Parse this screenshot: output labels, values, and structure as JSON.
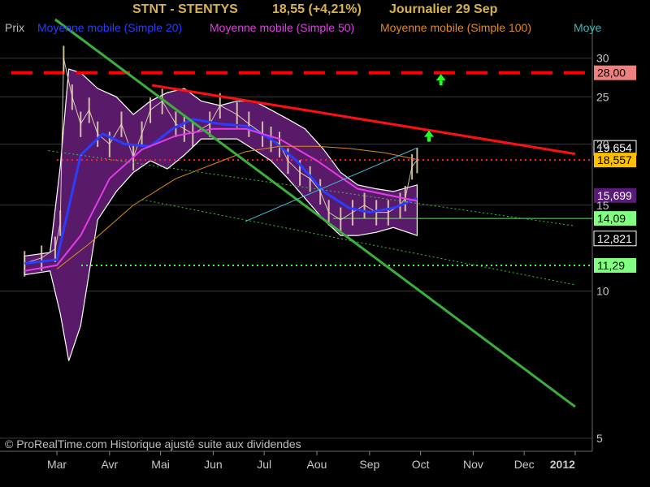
{
  "header": {
    "ticker": "STNT - STENTYS",
    "price": "18,55 (+4,21%)",
    "period": "Journalier  29 Sep"
  },
  "legend": [
    {
      "label": "Prix",
      "color": "#bdbdbd"
    },
    {
      "label": "Moyenne mobile (Simple 20)",
      "color": "#2a3cff"
    },
    {
      "label": "Moyenne mobile (Simple 50)",
      "color": "#e23ce6"
    },
    {
      "label": "Moyenne mobile (Simple 100)",
      "color": "#e08a1e"
    },
    {
      "label": "Moye",
      "color": "#3ab6b6"
    }
  ],
  "copyright": "© ProRealTime.com Historique ajusté suite aux dividendes",
  "chart_data": {
    "type": "line",
    "scale": "log",
    "background": "#000000",
    "grid": true,
    "x_tick_labels": [
      "Mar",
      "Avr",
      "Mai",
      "Jun",
      "Jul",
      "Aou",
      "Sep",
      "Oct",
      "Nov",
      "Dec",
      "2012"
    ],
    "y_tick_labels": [
      "5",
      "10",
      "15",
      "20",
      "25",
      "30"
    ],
    "ylim": [
      4.7,
      36
    ],
    "price_tags": [
      {
        "text": "28,00",
        "value": 28.0,
        "bg": "#f08080",
        "fg": "#000000"
      },
      {
        "text": "19,654",
        "value": 19.654,
        "bg": "#000000",
        "fg": "#ffffff",
        "border": "#ffffff"
      },
      {
        "text": "18,557",
        "value": 18.557,
        "bg": "#ffc000",
        "fg": "#000000"
      },
      {
        "text": "15,699",
        "value": 15.699,
        "bg": "#5a1a7a",
        "fg": "#ffffff"
      },
      {
        "text": "14,09",
        "value": 14.09,
        "bg": "#80ff80",
        "fg": "#000000"
      },
      {
        "text": "12,821",
        "value": 12.821,
        "bg": "#000000",
        "fg": "#ffffff",
        "border": "#ffffff"
      },
      {
        "text": "11,29",
        "value": 11.29,
        "bg": "#80ff80",
        "fg": "#000000"
      }
    ],
    "horizontal_lines": [
      {
        "name": "resistance-28",
        "value": 28.0,
        "color": "#ff0000",
        "style": "dashed-thick"
      },
      {
        "name": "level-18-55",
        "value": 18.557,
        "color": "#ff2020",
        "style": "dotted"
      },
      {
        "name": "level-14-09",
        "value": 14.09,
        "color": "#40ff40",
        "style": "solid-thin"
      },
      {
        "name": "level-11-29",
        "value": 11.29,
        "color": "#40ff40",
        "style": "dotted"
      }
    ],
    "trendlines": [
      {
        "name": "green-downtrend",
        "color": "#3ab03a",
        "points": [
          [
            "Feb 28",
            36
          ],
          [
            "Dec 31",
            5.8
          ]
        ]
      },
      {
        "name": "red-downtrend",
        "color": "#ff1010",
        "points": [
          [
            "Apr 26",
            26.4
          ],
          [
            "Dec 31",
            19.1
          ]
        ]
      },
      {
        "name": "channel-upper",
        "color": "#40c040",
        "points": [
          [
            "Feb 24",
            19.4
          ],
          [
            "Dec 31",
            13.6
          ]
        ]
      },
      {
        "name": "channel-lower",
        "color": "#40c040",
        "points": [
          [
            "Apr 20",
            15.4
          ],
          [
            "Dec 31",
            10.3
          ]
        ]
      },
      {
        "name": "cyan-uptrend",
        "color": "#40c0d0",
        "points": [
          [
            "Jun 20",
            13.9
          ],
          [
            "Sep 29",
            19.654
          ]
        ]
      }
    ],
    "arrows": [
      {
        "name": "up-arrow-1",
        "date": "Oct 13",
        "value": 27.0,
        "color": "#20ff20"
      },
      {
        "name": "up-arrow-2",
        "date": "Oct 06",
        "value": 20.7,
        "color": "#20ff20"
      }
    ],
    "series": [
      {
        "name": "Prix",
        "color": "#e8d8b8",
        "x": [
          "Feb 10",
          "Feb 20",
          "Feb 28",
          "Mar 3",
          "Mar 5",
          "Mar 10",
          "Mar 15",
          "Mar 20",
          "Mar 25",
          "Apr 1",
          "Apr 8",
          "Apr 15",
          "Apr 20",
          "Apr 25",
          "May 2",
          "May 10",
          "May 15",
          "May 20",
          "May 30",
          "Jun 5",
          "Jun 15",
          "Jun 22",
          "Jun 30",
          "Jul 5",
          "Jul 10",
          "Jul 15",
          "Jul 22",
          "Jul 28",
          "Aug 3",
          "Aug 8",
          "Aug 15",
          "Aug 22",
          "Aug 29",
          "Sep 5",
          "Sep 12",
          "Sep 19",
          "Sep 22",
          "Sep 26",
          "Sep 29"
        ],
        "values": [
          11.4,
          11.7,
          12.2,
          13.8,
          30.0,
          25.0,
          22.0,
          23.5,
          21.0,
          20.0,
          22.0,
          18.8,
          21.0,
          23.5,
          24.5,
          22.0,
          21.5,
          21.0,
          22.0,
          24.0,
          23.0,
          22.0,
          21.0,
          20.5,
          20.0,
          18.5,
          17.5,
          17.0,
          16.0,
          14.5,
          14.0,
          14.5,
          15.0,
          14.5,
          14.5,
          15.0,
          15.5,
          18.0,
          18.55
        ]
      },
      {
        "name": "Moyenne mobile (Simple 20)",
        "color": "#2a3cff",
        "x": [
          "Feb 10",
          "Mar 1",
          "Mar 15",
          "Mar 28",
          "Apr 10",
          "Apr 25",
          "May 8",
          "May 20",
          "Jun 5",
          "Jun 20",
          "Jul 5",
          "Jul 20",
          "Aug 5",
          "Aug 20",
          "Sep 1",
          "Sep 15",
          "Sep 29"
        ],
        "values": [
          11.4,
          11.6,
          19.0,
          21.0,
          20.0,
          19.8,
          21.5,
          22.5,
          22.0,
          21.8,
          20.5,
          18.5,
          16.0,
          14.8,
          14.5,
          14.8,
          15.5
        ]
      },
      {
        "name": "Moyenne mobile (Simple 50)",
        "color": "#e23ce6",
        "x": [
          "Feb 10",
          "Mar 1",
          "Mar 15",
          "Apr 1",
          "Apr 20",
          "May 10",
          "Jun 1",
          "Jun 20",
          "Jul 10",
          "Aug 1",
          "Aug 25",
          "Sep 29"
        ],
        "values": [
          11.0,
          11.3,
          13.0,
          17.0,
          19.5,
          20.8,
          21.5,
          21.5,
          20.5,
          18.5,
          16.2,
          15.3
        ]
      },
      {
        "name": "Moyenne mobile (Simple 100)",
        "color": "#e08a1e",
        "x": [
          "Mar 1",
          "Mar 20",
          "Apr 15",
          "May 10",
          "Jun 1",
          "Jun 20",
          "Jul 10",
          "Aug 1",
          "Aug 20",
          "Sep 10",
          "Sep 29"
        ],
        "values": [
          11.1,
          12.5,
          15.0,
          17.0,
          18.2,
          19.3,
          19.8,
          19.8,
          19.6,
          19.2,
          18.6
        ]
      }
    ],
    "bands": [
      {
        "name": "bollinger-band",
        "fill": "#5a1a6a",
        "stroke": "#ffffff",
        "x": [
          "Feb 10",
          "Feb 25",
          "Mar 3",
          "Mar 8",
          "Mar 15",
          "Mar 25",
          "Apr 5",
          "Apr 15",
          "Apr 25",
          "May 5",
          "May 15",
          "May 25",
          "Jun 5",
          "Jun 15",
          "Jun 25",
          "Jul 5",
          "Jul 15",
          "Jul 25",
          "Aug 5",
          "Aug 15",
          "Aug 25",
          "Sep 5",
          "Sep 15",
          "Sep 29"
        ],
        "upper": [
          11.8,
          12.0,
          18.0,
          28.5,
          28.0,
          26.0,
          25.0,
          23.0,
          24.5,
          25.5,
          26.0,
          24.5,
          24.0,
          24.5,
          24.5,
          23.5,
          22.5,
          21.5,
          19.5,
          17.5,
          16.5,
          16.2,
          16.0,
          16.5
        ],
        "lower": [
          10.8,
          11.0,
          9.0,
          7.2,
          8.5,
          14.0,
          16.0,
          17.5,
          18.5,
          17.8,
          19.0,
          20.5,
          20.5,
          20.5,
          19.5,
          18.5,
          17.0,
          15.5,
          14.0,
          13.0,
          13.0,
          13.2,
          13.5,
          13.0
        ]
      }
    ]
  }
}
